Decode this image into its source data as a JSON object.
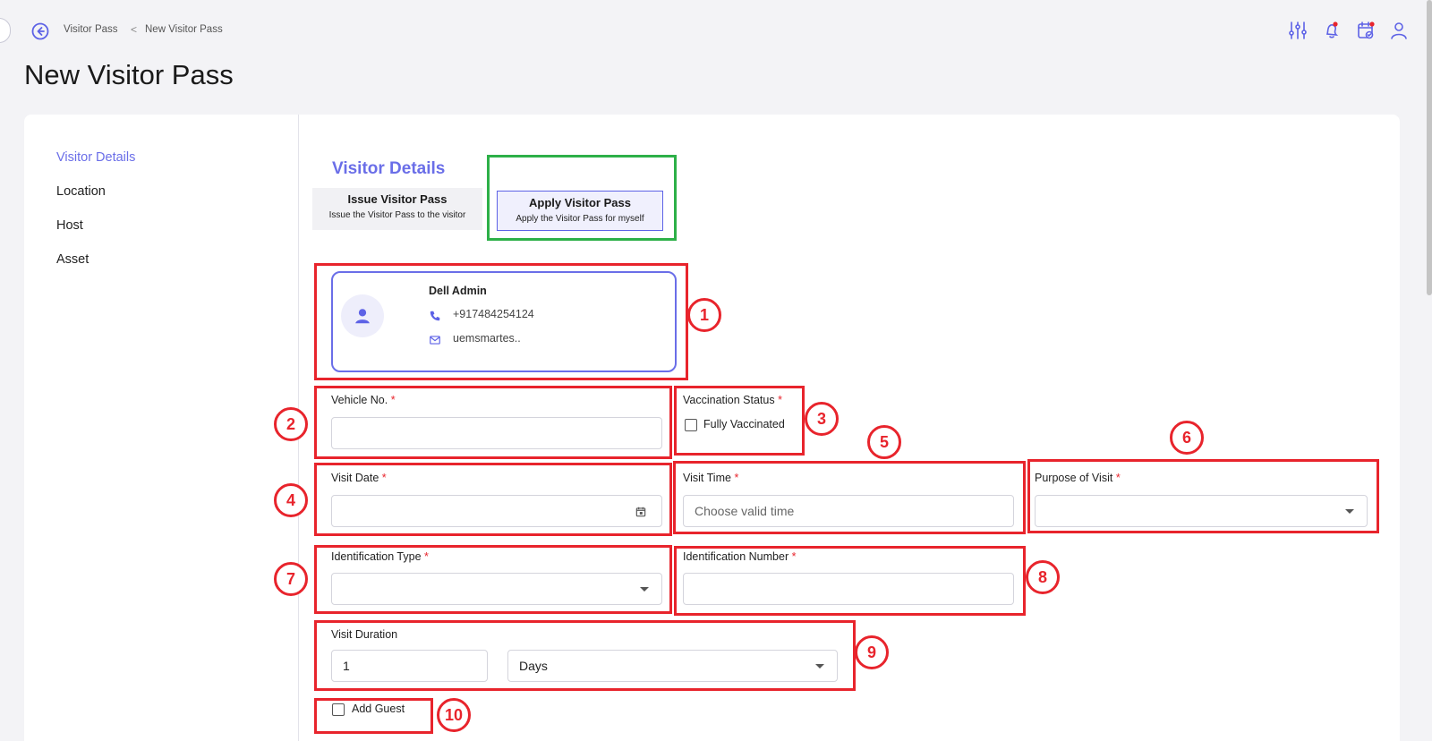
{
  "breadcrumb": {
    "parent": "Visitor Pass",
    "separator": "<",
    "current": "New Visitor Pass"
  },
  "page_title": "New Visitor Pass",
  "header_icons": [
    "sliders-icon",
    "notification-bell-icon",
    "calendar-check-icon",
    "user-profile-icon"
  ],
  "sidebar": {
    "items": [
      {
        "label": "Visitor Details",
        "active": true
      },
      {
        "label": "Location",
        "active": false
      },
      {
        "label": "Host",
        "active": false
      },
      {
        "label": "Asset",
        "active": false
      }
    ]
  },
  "section_title": "Visitor Details",
  "pass_options": {
    "issue": {
      "title": "Issue Visitor Pass",
      "subtitle": "Issue the Visitor Pass to the visitor"
    },
    "apply": {
      "title": "Apply Visitor Pass",
      "subtitle": "Apply the Visitor Pass for myself",
      "selected": true
    }
  },
  "profile": {
    "name": "Dell Admin",
    "phone": "+917484254124",
    "email": "uemsmartes.."
  },
  "form": {
    "vehicle_no": {
      "label": "Vehicle No.",
      "required": "*",
      "value": ""
    },
    "vaccination": {
      "label": "Vaccination Status",
      "required": "*",
      "option_label": "Fully Vaccinated",
      "checked": false
    },
    "visit_date": {
      "label": "Visit Date",
      "required": "*",
      "value": ""
    },
    "visit_time": {
      "label": "Visit Time",
      "required": "*",
      "placeholder": "Choose valid time"
    },
    "purpose": {
      "label": "Purpose of Visit",
      "required": "*",
      "value": ""
    },
    "id_type": {
      "label": "Identification Type",
      "required": "*",
      "value": ""
    },
    "id_number": {
      "label": "Identification Number",
      "required": "*",
      "value": ""
    },
    "duration": {
      "label": "Visit Duration",
      "value": "1",
      "unit": "Days"
    },
    "add_guest": {
      "label": "Add Guest",
      "checked": false
    }
  },
  "annotation_numbers": [
    "1",
    "2",
    "3",
    "4",
    "5",
    "6",
    "7",
    "8",
    "9",
    "10"
  ],
  "colors": {
    "accent": "#6a6ee8",
    "annotation_red": "#e8242c",
    "annotation_green": "#2db048"
  }
}
